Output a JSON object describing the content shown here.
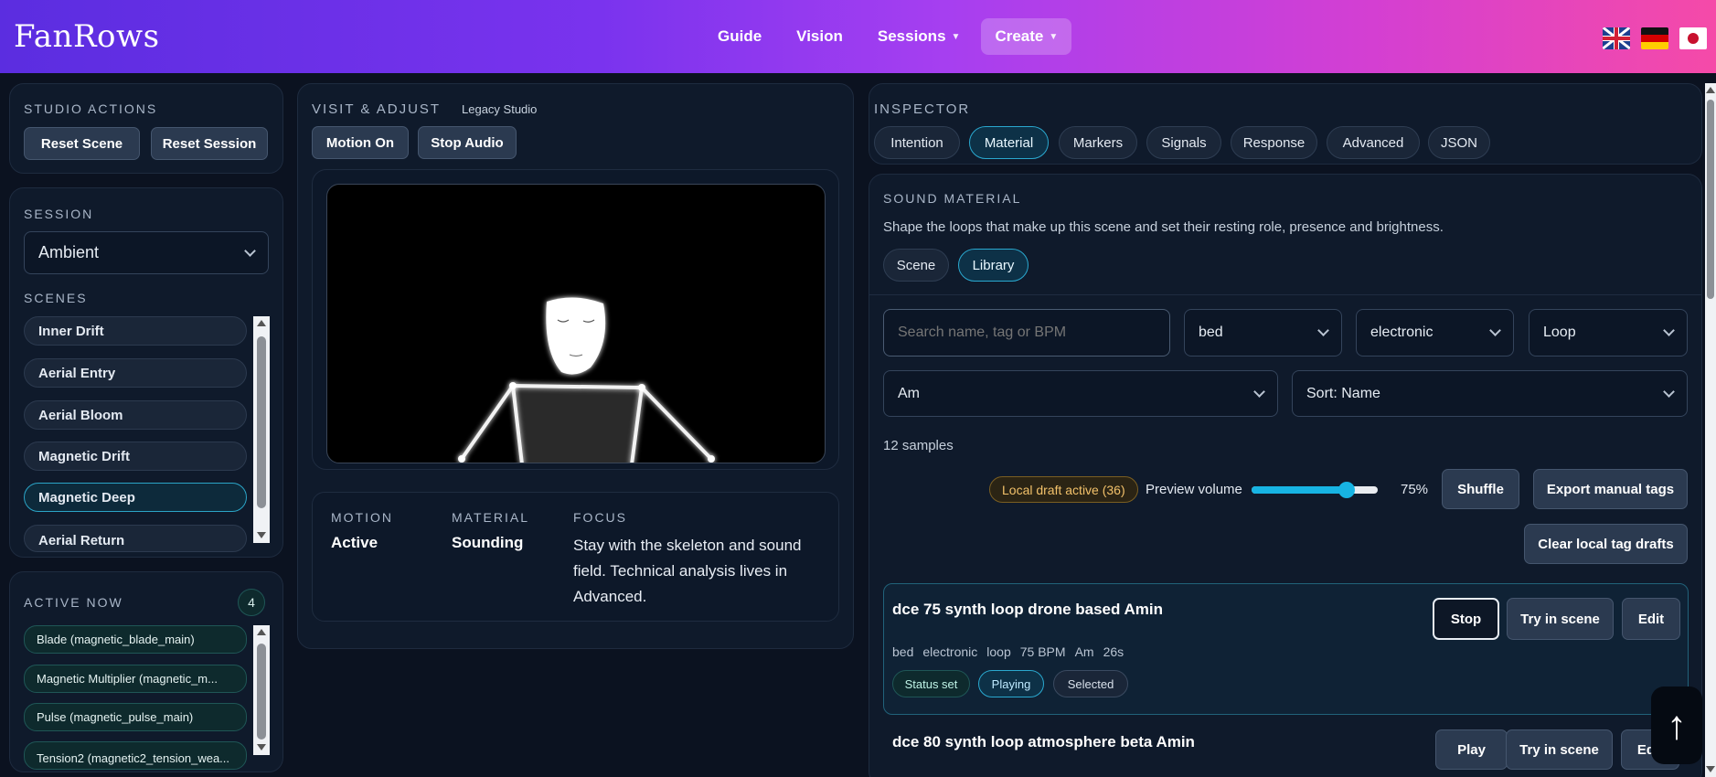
{
  "header": {
    "brand": "FanRows",
    "nav": [
      {
        "label": "Guide"
      },
      {
        "label": "Vision"
      },
      {
        "label": "Sessions"
      },
      {
        "label": "Create"
      }
    ]
  },
  "studio_actions": {
    "title": "STUDIO ACTIONS",
    "reset_scene": "Reset Scene",
    "reset_session": "Reset Session"
  },
  "session": {
    "title": "SESSION",
    "selected": "Ambient",
    "scenes_title": "SCENES",
    "scenes": [
      "Inner Drift",
      "Aerial Entry",
      "Aerial Bloom",
      "Magnetic Drift",
      "Magnetic Deep",
      "Aerial Return"
    ]
  },
  "active_now": {
    "title": "ACTIVE NOW",
    "count": "4",
    "items": [
      "Blade (magnetic_blade_main)",
      "Magnetic Multiplier (magnetic_m...",
      "Pulse (magnetic_pulse_main)",
      "Tension2 (magnetic2_tension_wea..."
    ]
  },
  "visit": {
    "title": "VISIT & ADJUST",
    "subtitle": "Legacy Studio",
    "motion_on": "Motion On",
    "stop_audio": "Stop Audio",
    "status": [
      {
        "label": "MOTION",
        "value": "Active"
      },
      {
        "label": "MATERIAL",
        "value": "Sounding"
      },
      {
        "label": "FOCUS",
        "value": "Stay with the skeleton and sound field. Technical analysis lives in Advanced."
      }
    ]
  },
  "inspector": {
    "title": "INSPECTOR",
    "tabs": [
      "Intention",
      "Material",
      "Markers",
      "Signals",
      "Response",
      "Advanced",
      "JSON"
    ]
  },
  "material": {
    "title": "SOUND MATERIAL",
    "description": "Shape the loops that make up this scene and set their resting role, presence and brightness.",
    "subtabs": [
      "Scene",
      "Library"
    ],
    "search_placeholder": "Search name, tag or BPM",
    "filters": {
      "role": "bed",
      "genre": "electronic",
      "type": "Loop",
      "key": "Am",
      "sort": "Sort: Name"
    },
    "sample_count": "12 samples",
    "draft_badge": "Local draft active (36)",
    "preview_volume_label": "Preview volume",
    "preview_volume_value": "75%",
    "preview_volume": 0.75,
    "shuffle": "Shuffle",
    "export_tags": "Export manual tags",
    "clear_drafts": "Clear local tag drafts",
    "samples": [
      {
        "name": "dce 75 synth loop drone based Amin",
        "meta": [
          "bed",
          "electronic",
          "loop",
          "75 BPM",
          "Am",
          "26s"
        ],
        "tags": [
          "Status set",
          "Playing",
          "Selected"
        ],
        "primary_action": "Stop",
        "try_label": "Try in scene",
        "edit_label": "Edit"
      },
      {
        "name": "dce 80 synth loop atmosphere beta Amin",
        "primary_action": "Play",
        "try_label": "Try in scene",
        "edit_label": "Edit"
      }
    ]
  },
  "colors": {
    "accent_cyan": "#2aa8cf",
    "background": "#0b1220",
    "card": "#0f1a2b",
    "draft_badge": "#f2c16a"
  }
}
